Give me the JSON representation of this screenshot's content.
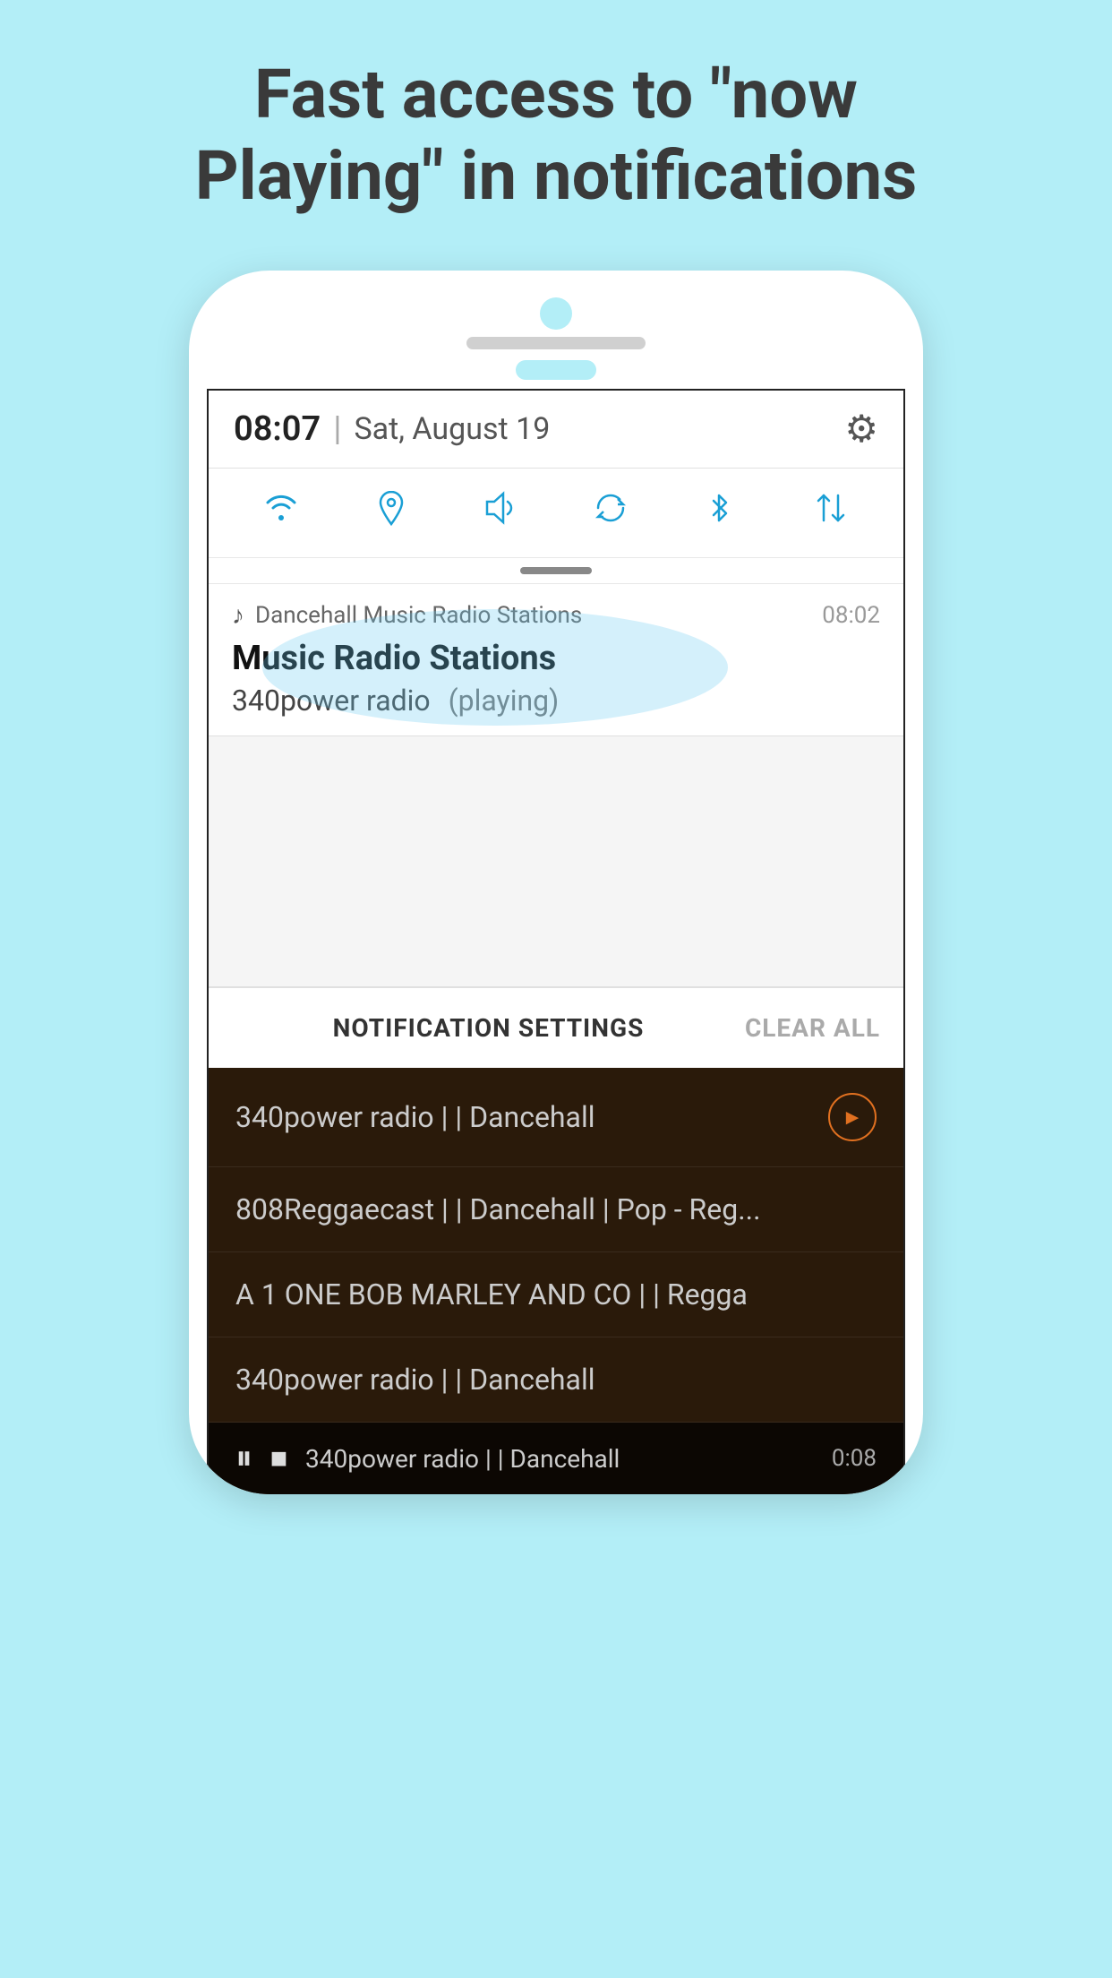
{
  "headline": {
    "line1": "Fast access to \"now",
    "line2": "Playing\" in notifications"
  },
  "statusBar": {
    "time": "08:07",
    "divider": "|",
    "date": "Sat, August 19"
  },
  "quickSettings": {
    "icons": [
      "wifi",
      "location",
      "volume",
      "sync",
      "bluetooth",
      "data-transfer"
    ]
  },
  "notification": {
    "appName": "Dancehall Music Radio Stations",
    "time": "08:02",
    "title": "Music Radio Stations",
    "subtitle": "340power radio",
    "playingLabel": "(playing)"
  },
  "bottomBar": {
    "settingsLabel": "NOTIFICATION SETTINGS",
    "clearLabel": "CLEAR ALL"
  },
  "radioList": [
    {
      "text": "340power radio | | Dancehall",
      "hasPlayIcon": true
    },
    {
      "text": "808Reggaecast | | Dancehall | Pop - Reg...",
      "hasPlayIcon": false
    },
    {
      "text": "A 1 ONE BOB MARLEY AND CO | | Regga",
      "hasPlayIcon": false
    },
    {
      "text": "340power radio | | Dancehall",
      "hasPlayIcon": false
    }
  ],
  "playerBar": {
    "text": "340power radio | | Dancehall",
    "time": "0:08"
  }
}
